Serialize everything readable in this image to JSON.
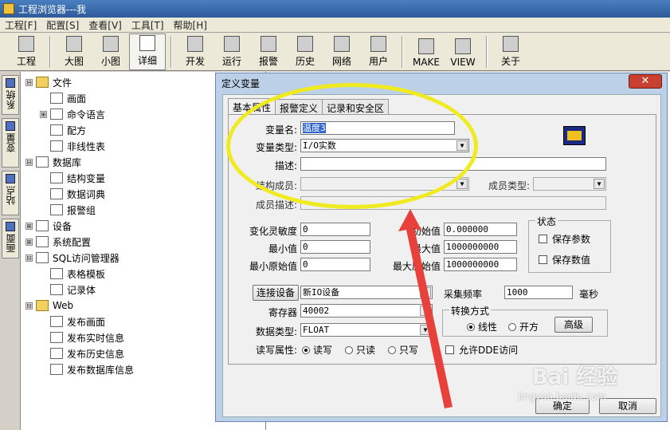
{
  "window": {
    "title": "工程浏览器---我"
  },
  "menu": [
    "工程[F]",
    "配置[S]",
    "查看[V]",
    "工具[T]",
    "帮助[H]"
  ],
  "toolbar": [
    {
      "label": "工程",
      "icon": "project-icon"
    },
    {
      "label": "大图",
      "icon": "large-icons-icon"
    },
    {
      "label": "小图",
      "icon": "small-icons-icon"
    },
    {
      "label": "详细",
      "icon": "details-icon",
      "selected": true
    },
    {
      "label": "开发",
      "icon": "develop-icon"
    },
    {
      "label": "运行",
      "icon": "run-icon"
    },
    {
      "label": "报警",
      "icon": "alarm-icon"
    },
    {
      "label": "历史",
      "icon": "history-icon"
    },
    {
      "label": "网络",
      "icon": "network-icon"
    },
    {
      "label": "用户",
      "icon": "user-icon"
    },
    {
      "label": "MAKE",
      "icon": "make-icon"
    },
    {
      "label": "VIEW",
      "icon": "view-icon"
    },
    {
      "label": "关于",
      "icon": "about-icon"
    }
  ],
  "side_tabs": [
    "系统",
    "变量",
    "站点",
    "画面"
  ],
  "tree": [
    {
      "label": "文件",
      "level": 0,
      "exp": "⊟",
      "icon": "folder"
    },
    {
      "label": "画面",
      "level": 1,
      "exp": "",
      "icon": "doc"
    },
    {
      "label": "命令语言",
      "level": 1,
      "exp": "⊞",
      "icon": "doc"
    },
    {
      "label": "配方",
      "level": 1,
      "exp": "",
      "icon": "doc"
    },
    {
      "label": "非线性表",
      "level": 1,
      "exp": "",
      "icon": "doc"
    },
    {
      "label": "数据库",
      "level": 0,
      "exp": "⊟",
      "icon": "doc"
    },
    {
      "label": "结构变量",
      "level": 1,
      "exp": "",
      "icon": "doc"
    },
    {
      "label": "数据词典",
      "level": 1,
      "exp": "",
      "icon": "doc"
    },
    {
      "label": "报警组",
      "level": 1,
      "exp": "",
      "icon": "doc"
    },
    {
      "label": "设备",
      "level": 0,
      "exp": "⊞",
      "icon": "doc"
    },
    {
      "label": "系统配置",
      "level": 0,
      "exp": "⊞",
      "icon": "doc"
    },
    {
      "label": "SQL访问管理器",
      "level": 0,
      "exp": "⊟",
      "icon": "doc"
    },
    {
      "label": "表格模板",
      "level": 1,
      "exp": "",
      "icon": "doc"
    },
    {
      "label": "记录体",
      "level": 1,
      "exp": "",
      "icon": "doc"
    },
    {
      "label": "Web",
      "level": 0,
      "exp": "⊟",
      "icon": "folder"
    },
    {
      "label": "发布画面",
      "level": 1,
      "exp": "",
      "icon": "doc"
    },
    {
      "label": "发布实时信息",
      "level": 1,
      "exp": "",
      "icon": "doc"
    },
    {
      "label": "发布历史信息",
      "level": 1,
      "exp": "",
      "icon": "doc"
    },
    {
      "label": "发布数据库信息",
      "level": 1,
      "exp": "",
      "icon": "doc"
    }
  ],
  "dialog": {
    "title": "定义变量",
    "close": "✕",
    "tabs": [
      "基本属性",
      "报警定义",
      "记录和安全区"
    ],
    "var_name_label": "变量名:",
    "var_name": "温度3",
    "var_type_label": "变量类型:",
    "var_type": "I/O实数",
    "desc_label": "描述:",
    "desc": "",
    "struct_member_label": "结构成员:",
    "member_type_label": "成员类型:",
    "member_desc_label": "成员描述:",
    "sensitivity_label": "变化灵敏度",
    "sensitivity": "0",
    "min_label": "最小值",
    "min": "0",
    "min_raw_label": "最小原始值",
    "min_raw": "0",
    "init_label": "初始值",
    "init": "0.000000",
    "max_label": "最大值",
    "max": "1000000000",
    "max_raw_label": "最大原始值",
    "max_raw": "1000000000",
    "status_title": "状态",
    "save_param": "保存参数",
    "save_value": "保存数值",
    "connect_device_btn": "连接设备",
    "device": "新IO设备",
    "sample_label": "采集频率",
    "sample": "1000",
    "sample_unit": "毫秒",
    "register_label": "寄存器",
    "register": "40002",
    "datatype_label": "数据类型:",
    "datatype": "FLOAT",
    "convert_title": "转换方式",
    "linear": "线性",
    "sqrt": "开方",
    "advanced_btn": "高级",
    "rw_label": "读写属性:",
    "rw": "读写",
    "ro": "只读",
    "wo": "只写",
    "dde": "允许DDE访问",
    "ok_btn": "确定",
    "cancel_btn": "取消"
  },
  "watermark": {
    "text": "Bai 经验",
    "sub": "jingyan.baidu.com"
  }
}
